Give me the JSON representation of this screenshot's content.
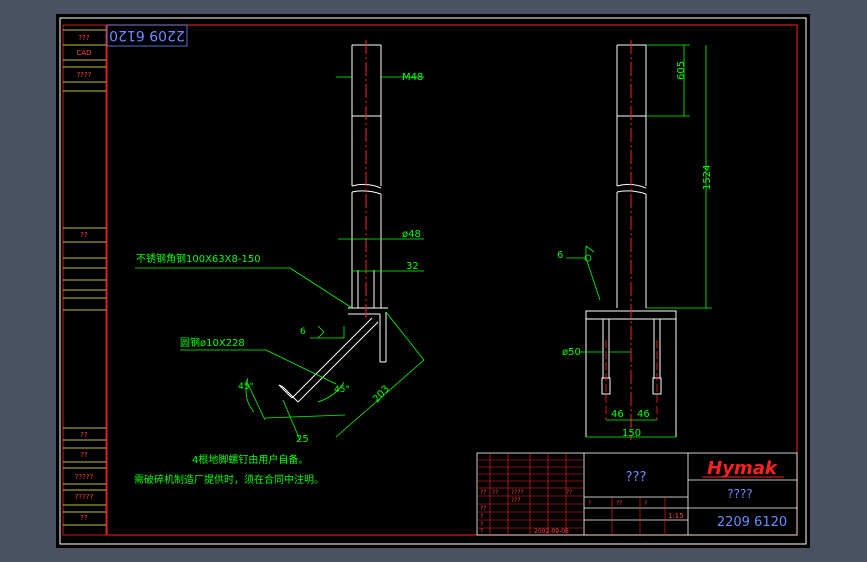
{
  "colors": {
    "background": "#4a5261",
    "paper": "#000000",
    "border": "#ffffff",
    "frame": "#ff2020",
    "dimension": "#00ff00",
    "centerline": "#ff2020",
    "part": "#ffffff",
    "note": "#00ff00",
    "titleblock_text": "#6a8cff",
    "hymak": "#ff2020"
  },
  "drawing_number_rotated": "2209 6120",
  "left_column_labels": [
    "???",
    "CAD",
    "????",
    "??",
    "??",
    "??",
    "?????",
    "?????",
    "??"
  ],
  "front_view": {
    "dims": {
      "thread": "M48",
      "diameter": "ø48",
      "offset": "32",
      "length_203": "203",
      "length_25": "25",
      "angle_left": "45°",
      "angle_right": "45°",
      "weld": "6"
    },
    "leader_angle_steel": "不锈钢角钢100X63X8-150",
    "leader_round_steel": "圆钢ø10X228"
  },
  "side_view": {
    "dims": {
      "top": "605",
      "mid": "1524",
      "dia": "ø50",
      "spacing_left": "46",
      "spacing_right": "46",
      "base_width": "150",
      "weld": "6"
    }
  },
  "notes": [
    "4根地脚螺钉由用户自备。",
    "需破碎机制造厂提供时，须在合同中注明。"
  ],
  "title_block": {
    "title": "???",
    "company": "Hymak",
    "name": "????",
    "drawing_number": "2209 6120",
    "scale": "1:15",
    "date": "2002-09-06",
    "small_labels": [
      "??",
      "??",
      "????",
      "???",
      "??",
      "??",
      "?",
      "?",
      "?",
      "?",
      "??",
      "?"
    ]
  }
}
